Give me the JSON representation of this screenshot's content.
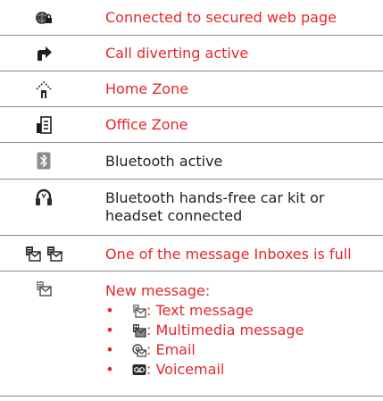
{
  "colors": {
    "label_red": "#e8262a",
    "label_black": "#222222",
    "rule": "#8a8a8a"
  },
  "rows": [
    {
      "icon": "secure-web-globe-icon",
      "label": "Connected to secured web page"
    },
    {
      "icon": "call-divert-arrow-icon",
      "label": "Call diverting active"
    },
    {
      "icon": "home-zone-icon",
      "label": "Home Zone"
    },
    {
      "icon": "office-zone-icon",
      "label": "Office Zone"
    },
    {
      "icon": "bluetooth-icon",
      "label": "Bluetooth active"
    },
    {
      "icon": "headset-icon",
      "label_line1": "Bluetooth hands-free car kit or",
      "label_line2": "headset connected"
    },
    {
      "icon": "inbox-full-icon",
      "label": "One of the message Inboxes is full"
    },
    {
      "icon": "new-message-icon",
      "label": "New message:"
    }
  ],
  "new_message_types": [
    {
      "bullet": "•",
      "icon": "text-message-icon",
      "label": ": Text message"
    },
    {
      "bullet": "•",
      "icon": "multimedia-message-icon",
      "label": ": Multimedia message"
    },
    {
      "bullet": "•",
      "icon": "email-icon",
      "label": ": Email"
    },
    {
      "bullet": "•",
      "icon": "voicemail-icon",
      "label": ": Voicemail"
    }
  ]
}
